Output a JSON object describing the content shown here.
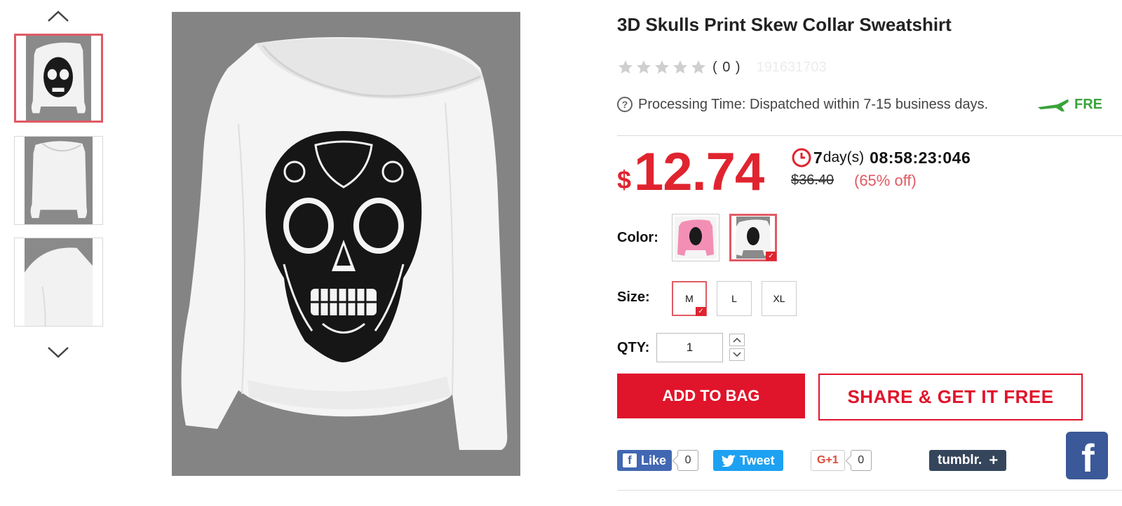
{
  "gallery": {
    "prev_icon": "chevron-up-icon",
    "next_icon": "chevron-down-icon",
    "thumbnails": [
      "front-view",
      "back-view",
      "shoulder-detail"
    ],
    "active_index": 0
  },
  "product": {
    "title": "3D Skulls Print Skew Collar Sweatshirt",
    "rating_stars": 5,
    "rating_filled": 0,
    "rating_count": "( 0 )",
    "sku": "191631703",
    "processing_text": "Processing Time: Dispatched within 7-15 business days.",
    "shipping_text": "FRE"
  },
  "pricing": {
    "currency": "$",
    "price": "12.74",
    "countdown_days": "7",
    "countdown_unit": "day(s)",
    "countdown_time": "08:58:23:046",
    "original_price": "$36.40",
    "discount": "(65% off)",
    "accent_color": "#e0242f"
  },
  "options": {
    "color_label": "Color:",
    "colors": [
      "pink",
      "white"
    ],
    "selected_color": "white",
    "size_label": "Size:",
    "sizes": [
      "M",
      "L",
      "XL"
    ],
    "selected_size": "M",
    "qty_label": "QTY:",
    "qty_value": "1"
  },
  "actions": {
    "add_to_bag": "ADD TO BAG",
    "share": "SHARE & GET IT FREE"
  },
  "social": {
    "fb_like": "Like",
    "fb_count": "0",
    "tweet": "Tweet",
    "gplus": "G+1",
    "gplus_count": "0",
    "tumblr": "tumblr.",
    "tumblr_plus": "+",
    "fb_big": "f"
  }
}
